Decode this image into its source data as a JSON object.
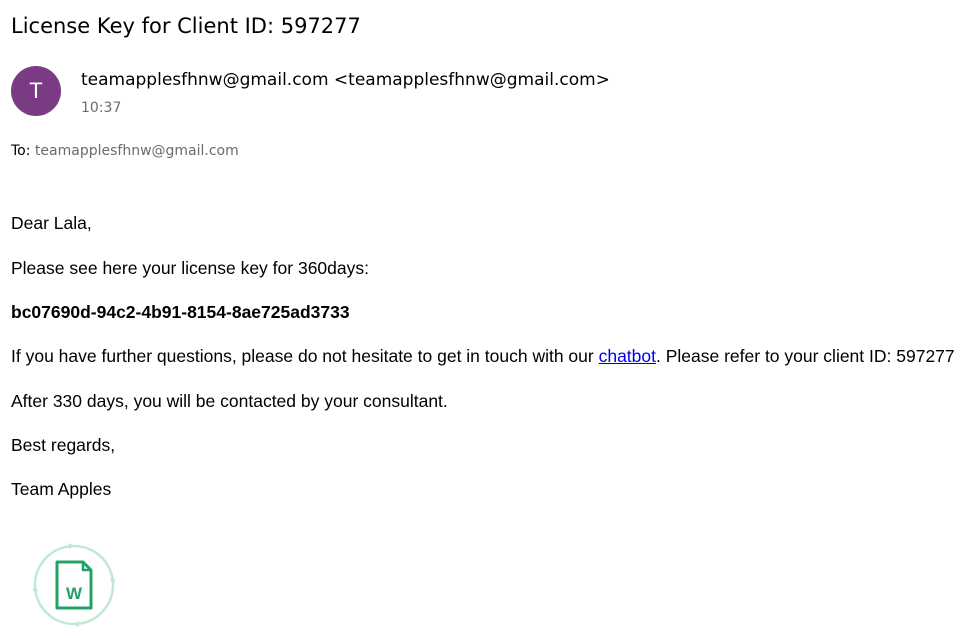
{
  "email": {
    "subject": "License Key for Client ID: 597277",
    "avatar_initial": "T",
    "sender": "teamapplesfhnw@gmail.com <teamapplesfhnw@gmail.com>",
    "time": "10:37",
    "to_label": "To:",
    "to_value": "teamapplesfhnw@gmail.com"
  },
  "body": {
    "greeting": "Dear Lala,",
    "intro": "Please see here your license key for 360days:",
    "license_key": "bc07690d-94c2-4b91-8154-8ae725ad3733",
    "questions_before": "If you have further questions, please do not hesitate to get in touch with our ",
    "chatbot_link": "chatbot",
    "questions_after": ". Please refer to your client ID: 597277",
    "contact_note": "After 330 days, you will be contacted by your consultant.",
    "closing": "Best regards,",
    "signature": "Team Apples"
  },
  "attachment": {
    "icon": "word-document-icon",
    "icon_letter": "W",
    "accent_color": "#21a366",
    "ring_color": "#bfe8d6"
  },
  "colors": {
    "avatar_bg": "#7a3b82",
    "muted_text": "#6b6b6b",
    "link": "#0000ee"
  }
}
